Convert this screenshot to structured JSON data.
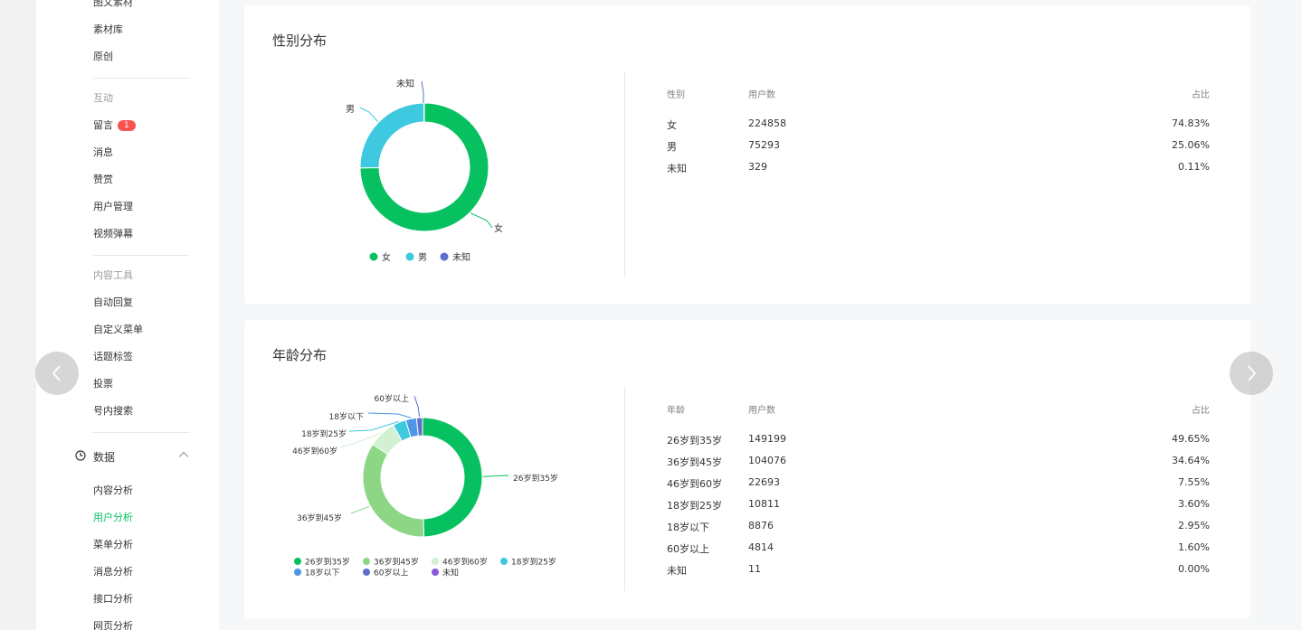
{
  "sidebar": {
    "top_partial": "图文素材",
    "items_a": [
      "素材库",
      "原创"
    ],
    "group_interact": "互动",
    "items_interact": [
      "留言",
      "消息",
      "赞赏",
      "用户管理",
      "视频弹幕"
    ],
    "message_badge": "1",
    "group_tools": "内容工具",
    "items_tools": [
      "自动回复",
      "自定义菜单",
      "话题标签",
      "投票",
      "号内搜索"
    ],
    "data_section": "数据",
    "items_data": [
      "内容分析",
      "用户分析",
      "菜单分析",
      "消息分析",
      "接口分析",
      "网页分析"
    ],
    "active_item": "用户分析"
  },
  "gender": {
    "title": "性别分布",
    "headers": {
      "col1": "性别",
      "col2": "用户数",
      "col3": "占比"
    },
    "rows": [
      {
        "label": "女",
        "count": "224858",
        "pct": "74.83%"
      },
      {
        "label": "男",
        "count": "75293",
        "pct": "25.06%"
      },
      {
        "label": "未知",
        "count": "329",
        "pct": "0.11%"
      }
    ]
  },
  "age": {
    "title": "年龄分布",
    "headers": {
      "col1": "年龄",
      "col2": "用户数",
      "col3": "占比"
    },
    "rows": [
      {
        "label": "26岁到35岁",
        "count": "149199",
        "pct": "49.65%"
      },
      {
        "label": "36岁到45岁",
        "count": "104076",
        "pct": "34.64%"
      },
      {
        "label": "46岁到60岁",
        "count": "22693",
        "pct": "7.55%"
      },
      {
        "label": "18岁到25岁",
        "count": "10811",
        "pct": "3.60%"
      },
      {
        "label": "18岁以下",
        "count": "8876",
        "pct": "2.95%"
      },
      {
        "label": "60岁以上",
        "count": "4814",
        "pct": "1.60%"
      },
      {
        "label": "未知",
        "count": "11",
        "pct": "0.00%"
      }
    ]
  },
  "chart_data": [
    {
      "type": "pie",
      "title": "",
      "categories": [
        "女",
        "男",
        "未知"
      ],
      "values": [
        224858,
        75293,
        329
      ],
      "colors": [
        "#07c160",
        "#3ec9e0",
        "#5b6fce"
      ],
      "legend": "bottom"
    },
    {
      "type": "pie",
      "title": "",
      "categories": [
        "26岁到35岁",
        "36岁到45岁",
        "46岁到60岁",
        "18岁到25岁",
        "18岁以下",
        "60岁以上",
        "未知"
      ],
      "values": [
        149199,
        104076,
        22693,
        10811,
        8876,
        4814,
        11
      ],
      "colors": [
        "#07c160",
        "#8cd686",
        "#d2f0d2",
        "#3ec9e0",
        "#4e96e6",
        "#5b6fce",
        "#8c57d8"
      ],
      "legend": "bottom"
    }
  ],
  "colors": {
    "accent": "#07c160",
    "badge": "#fa5151"
  },
  "icons": {
    "prev": "chevron-left-icon",
    "next": "chevron-right-icon",
    "data": "clock-icon",
    "collapse": "chevron-up-icon"
  }
}
